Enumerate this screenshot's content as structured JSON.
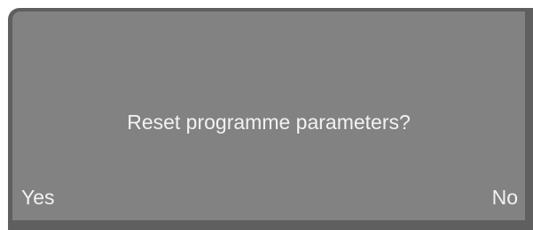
{
  "dialog": {
    "message": "Reset programme parameters?",
    "yes_label": "Yes",
    "no_label": "No"
  },
  "colors": {
    "bezel": "#5f5f5f",
    "screen": "#828282",
    "text": "#f2f2f2"
  }
}
